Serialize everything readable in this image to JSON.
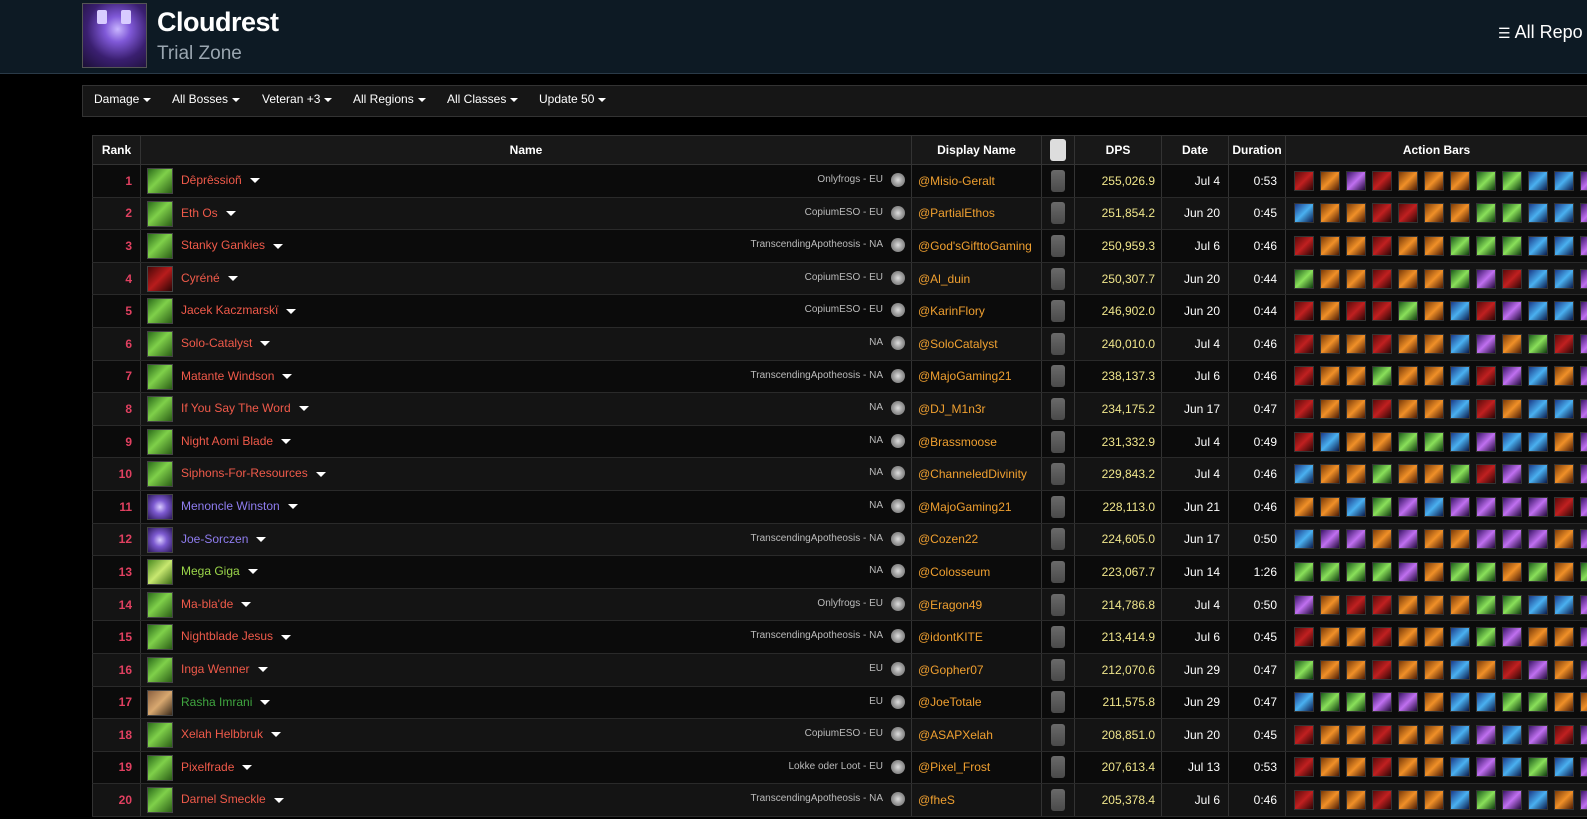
{
  "header": {
    "title": "Cloudrest",
    "subtitle": "Trial Zone",
    "all_reports_label": "All Repo"
  },
  "filters": [
    {
      "label": "Damage"
    },
    {
      "label": "All Bosses"
    },
    {
      "label": "Veteran +3"
    },
    {
      "label": "All Regions"
    },
    {
      "label": "All Classes"
    },
    {
      "label": "Update 50"
    }
  ],
  "table": {
    "columns": [
      "Rank",
      "Name",
      "Display Name",
      "YouTube",
      "DPS",
      "Date",
      "Duration",
      "Action Bars"
    ],
    "rows": [
      {
        "rank": "1",
        "name": "Dêprêssioñ",
        "guild": "Onlyfrogs - EU",
        "display": "@Misio-Geralt",
        "dps": "255,026.9",
        "date": "Jul 4",
        "duration": "0:53",
        "spec": "green",
        "color": "red"
      },
      {
        "rank": "2",
        "name": "Eth Os",
        "guild": "CopiumESO - EU",
        "display": "@PartialEthos",
        "dps": "251,854.2",
        "date": "Jun 20",
        "duration": "0:45",
        "spec": "green",
        "color": "red"
      },
      {
        "rank": "3",
        "name": "Stanky Gankies",
        "guild": "TranscendingApotheosis - NA",
        "display": "@God'sGifttoGaming",
        "dps": "250,959.3",
        "date": "Jul 6",
        "duration": "0:46",
        "spec": "green",
        "color": "red"
      },
      {
        "rank": "4",
        "name": "Cyréné",
        "guild": "CopiumESO - EU",
        "display": "@Al_duin",
        "dps": "250,307.7",
        "date": "Jun 20",
        "duration": "0:44",
        "spec": "red",
        "color": "red"
      },
      {
        "rank": "5",
        "name": "Jacek Kaczmarskï",
        "guild": "CopiumESO - EU",
        "display": "@KarinFlory",
        "dps": "246,902.0",
        "date": "Jun 20",
        "duration": "0:44",
        "spec": "green",
        "color": "red"
      },
      {
        "rank": "6",
        "name": "Solo-Catalyst",
        "guild": "NA",
        "display": "@SoloCatalyst",
        "dps": "240,010.0",
        "date": "Jul 4",
        "duration": "0:46",
        "spec": "green",
        "color": "red"
      },
      {
        "rank": "7",
        "name": "Matante Windson",
        "guild": "TranscendingApotheosis - NA",
        "display": "@MajoGaming21",
        "dps": "238,137.3",
        "date": "Jul 6",
        "duration": "0:46",
        "spec": "green",
        "color": "red"
      },
      {
        "rank": "8",
        "name": "If You Say The Word",
        "guild": "NA",
        "display": "@DJ_M1n3r",
        "dps": "234,175.2",
        "date": "Jun 17",
        "duration": "0:47",
        "spec": "green",
        "color": "red"
      },
      {
        "rank": "9",
        "name": "Night Aomi Blade",
        "guild": "NA",
        "display": "@Brassmoose",
        "dps": "231,332.9",
        "date": "Jul 4",
        "duration": "0:49",
        "spec": "green",
        "color": "red"
      },
      {
        "rank": "10",
        "name": "Siphons-For-Resources",
        "guild": "NA",
        "display": "@ChanneledDivinity",
        "dps": "229,843.2",
        "date": "Jul 4",
        "duration": "0:46",
        "spec": "green",
        "color": "red"
      },
      {
        "rank": "11",
        "name": "Menoncle Winston",
        "guild": "NA",
        "display": "@MajoGaming21",
        "dps": "228,113.0",
        "date": "Jun 21",
        "duration": "0:46",
        "spec": "purple",
        "color": "warden"
      },
      {
        "rank": "12",
        "name": "Joe-Sorczen",
        "guild": "TranscendingApotheosis - NA",
        "display": "@Cozen22",
        "dps": "224,605.0",
        "date": "Jun 17",
        "duration": "0:50",
        "spec": "purple",
        "color": "warden"
      },
      {
        "rank": "13",
        "name": "Mega Giga",
        "guild": "NA",
        "display": "@Colosseum",
        "dps": "223,067.7",
        "date": "Jun 14",
        "duration": "1:26",
        "spec": "green2",
        "color": "green"
      },
      {
        "rank": "14",
        "name": "Ma-bla'de",
        "guild": "Onlyfrogs - EU",
        "display": "@Eragon49",
        "dps": "214,786.8",
        "date": "Jul 4",
        "duration": "0:50",
        "spec": "green",
        "color": "red"
      },
      {
        "rank": "15",
        "name": "Nightblade Jesus",
        "guild": "TranscendingApotheosis - NA",
        "display": "@idontKITE",
        "dps": "213,414.9",
        "date": "Jul 6",
        "duration": "0:45",
        "spec": "green",
        "color": "red"
      },
      {
        "rank": "16",
        "name": "Inga Wenner",
        "guild": "EU",
        "display": "@Gopher07",
        "dps": "212,070.6",
        "date": "Jun 29",
        "duration": "0:47",
        "spec": "green",
        "color": "red"
      },
      {
        "rank": "17",
        "name": "Rasha Imrani",
        "guild": "EU",
        "display": "@JoeTotale",
        "dps": "211,575.8",
        "date": "Jun 29",
        "duration": "0:47",
        "spec": "brown",
        "color": "dkgreen"
      },
      {
        "rank": "18",
        "name": "Xelah Helbbruk",
        "guild": "CopiumESO - EU",
        "display": "@ASAPXelah",
        "dps": "208,851.0",
        "date": "Jun 20",
        "duration": "0:45",
        "spec": "green",
        "color": "red"
      },
      {
        "rank": "19",
        "name": "Pixelfrade",
        "guild": "Lokke oder Loot - EU",
        "display": "@Pixel_Frost",
        "dps": "207,613.4",
        "date": "Jul 13",
        "duration": "0:53",
        "spec": "green",
        "color": "red"
      },
      {
        "rank": "20",
        "name": "Darnel Smeckle",
        "guild": "TranscendingApotheosis - NA",
        "display": "@fheS",
        "dps": "205,378.4",
        "date": "Jul 6",
        "duration": "0:46",
        "spec": "green",
        "color": "red"
      }
    ]
  },
  "colors": {
    "rank": "#e04060",
    "dps": "#f0e68c",
    "display_name": "#f0a030",
    "name_red": "#f05a4a",
    "name_warden": "#8f7df0",
    "header_bg": "#0d1a24"
  },
  "icons": {
    "all_reports": "list-icon",
    "server": "server-icon",
    "youtube": "youtube-icon",
    "filter_caret": "chevron-down-icon"
  }
}
